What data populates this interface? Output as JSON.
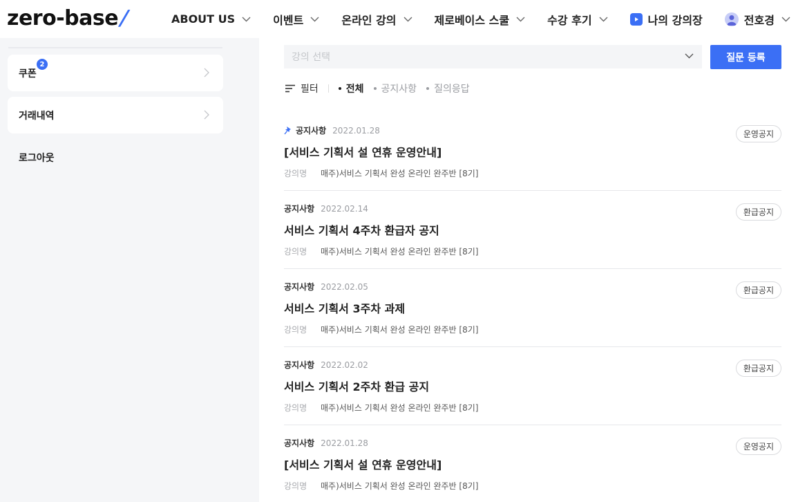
{
  "header": {
    "logo_text": "zero-base",
    "logo_slash": "/",
    "nav": [
      {
        "label": "ABOUT US",
        "dropdown": true
      },
      {
        "label": "이벤트",
        "dropdown": true
      },
      {
        "label": "온라인 강의",
        "dropdown": true
      },
      {
        "label": "제로베이스 스쿨",
        "dropdown": true
      },
      {
        "label": "수강 후기",
        "dropdown": true
      }
    ],
    "my_classroom": "나의 강의장",
    "user_name": "전호경"
  },
  "sidebar": {
    "items": [
      {
        "label": "쿠폰",
        "badge": "2"
      },
      {
        "label": "거래내역"
      }
    ],
    "logout": "로그아웃"
  },
  "main": {
    "course_select_placeholder": "강의 선택",
    "submit_button": "질문 등록",
    "filter_label": "필터",
    "tabs": [
      {
        "label": "전체",
        "active": true
      },
      {
        "label": "공지사항",
        "active": false
      },
      {
        "label": "질의응답",
        "active": false
      }
    ],
    "posts": [
      {
        "pinned": true,
        "category": "공지사항",
        "date": "2022.01.28",
        "title": "[서비스 기획서 설 연휴 운영안내]",
        "course_label": "강의명",
        "course": "매주)서비스 기획서 완성 온라인 완주반 [8기]",
        "tag": "운영공지"
      },
      {
        "pinned": false,
        "category": "공지사항",
        "date": "2022.02.14",
        "title": "서비스 기획서 4주차 환급자 공지",
        "course_label": "강의명",
        "course": "매주)서비스 기획서 완성 온라인 완주반 [8기]",
        "tag": "환급공지"
      },
      {
        "pinned": false,
        "category": "공지사항",
        "date": "2022.02.05",
        "title": "서비스 기획서 3주차 과제",
        "course_label": "강의명",
        "course": "매주)서비스 기획서 완성 온라인 완주반 [8기]",
        "tag": "환급공지"
      },
      {
        "pinned": false,
        "category": "공지사항",
        "date": "2022.02.02",
        "title": "서비스 기획서 2주차 환급 공지",
        "course_label": "강의명",
        "course": "매주)서비스 기획서 완성 온라인 완주반 [8기]",
        "tag": "환급공지"
      },
      {
        "pinned": false,
        "category": "공지사항",
        "date": "2022.01.28",
        "title": "[서비스 기획서 설 연휴 운영안내]",
        "course_label": "강의명",
        "course": "매주)서비스 기획서 완성 온라인 완주반 [8기]",
        "tag": "운영공지"
      }
    ]
  },
  "colors": {
    "accent": "#3b6ff5",
    "sidebar_bg": "#f5f6f8",
    "muted_text": "#9a9ca1"
  }
}
